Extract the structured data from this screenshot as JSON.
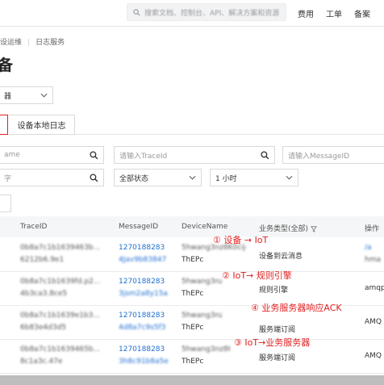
{
  "topbar": {
    "search_placeholder": "搜索文档、控制台、API、解决方案和资源",
    "links": [
      "费用",
      "工单",
      "备案"
    ]
  },
  "breadcrumb": [
    "设运维",
    "日志服务"
  ],
  "page_title": "备",
  "instance_select": {
    "value": "器"
  },
  "tabs": {
    "local_log": "设备本地日志"
  },
  "filters": {
    "devicename_placeholder": "ame",
    "traceid_placeholder": "请输入TraceId",
    "messageid_placeholder": "请输入MessageID",
    "keyword_placeholder": "字",
    "status_value": "全部状态",
    "time_value": "1 小时"
  },
  "table": {
    "headers": [
      "TraceID",
      "MessageID",
      "DeviceName",
      "业务类型(全部)",
      "操作"
    ],
    "rows": [
      {
        "trace1": "0b8a7c1b1639463b...",
        "trace2": "6212b6.9e1",
        "msg1": "1270188283",
        "msg2": "4Jav9b83847",
        "dev1": "5hwang3nz8K0cijc",
        "dev2": "ThEPc",
        "type": "设备到云消息",
        "op1": "/a",
        "op2": "hma"
      },
      {
        "trace1": "0b8a7c1b1639fd.p2...",
        "trace2": "4b3ca3.8ce5",
        "msg1": "1270188283",
        "msg2": "3jsm2a8y15a",
        "dev1": "5hwang3nz8K0ci",
        "dev2": "ThEPc",
        "type": "规则引擎",
        "op1": "amqp",
        "op2": ""
      },
      {
        "trace1": "0b8a7c1b1639e1b3...",
        "trace2": "6b83e4d3d5",
        "msg1": "1270188283",
        "msg2": "4d8a7c9s5f3",
        "dev1": "5hwang3nz8K0",
        "dev2": "ThEPc",
        "type": "服务端订阅",
        "op1": "AMQ",
        "op2": ""
      },
      {
        "trace1": "0b8a7c1b1639465b...",
        "trace2": "8c1a3c.47e",
        "msg1": "1270188283",
        "msg2": "3h8c91b8a5e",
        "dev1": "5hwang3nz8K0cijc",
        "dev2": "ThEPc",
        "type": "服务端订阅",
        "op1": "AMQ",
        "op2": ""
      }
    ]
  },
  "annotations": [
    "① 设备 → IoT",
    "② IoT→ 规则引擎",
    "④ 业务服务器响应ACK",
    "③ IoT→业务服务器"
  ]
}
